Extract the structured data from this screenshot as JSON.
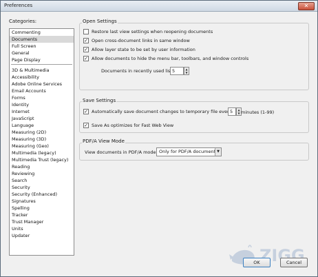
{
  "window": {
    "title": "Preferences",
    "close_glyph": "✕"
  },
  "categories": {
    "label": "Categories:",
    "top": [
      "Commenting",
      "Documents",
      "Full Screen",
      "General",
      "Page Display"
    ],
    "selected": "Documents",
    "rest": [
      "3D & Multimedia",
      "Accessibility",
      "Adobe Online Services",
      "Email Accounts",
      "Forms",
      "Identity",
      "Internet",
      "JavaScript",
      "Language",
      "Measuring (2D)",
      "Measuring (3D)",
      "Measuring (Geo)",
      "Multimedia (legacy)",
      "Multimedia Trust (legacy)",
      "Reading",
      "Reviewing",
      "Search",
      "Security",
      "Security (Enhanced)",
      "Signatures",
      "Spelling",
      "Tracker",
      "Trust Manager",
      "Units",
      "Updater"
    ]
  },
  "open_settings": {
    "title": "Open Settings",
    "options": [
      {
        "label": "Restore last view settings when reopening documents",
        "checked": false
      },
      {
        "label": "Open cross-document links in same window",
        "checked": true
      },
      {
        "label": "Allow layer state to be set by user information",
        "checked": true
      },
      {
        "label": "Allow documents to hide the menu bar, toolbars, and window controls",
        "checked": true
      }
    ],
    "recent_label": "Documents in recently used list:",
    "recent_value": "5"
  },
  "save_settings": {
    "title": "Save Settings",
    "autosave_label": "Automatically save document changes to temporary file every:",
    "autosave_checked": true,
    "autosave_value": "5",
    "minutes_label": "minutes (1-99)",
    "fast_web_label": "Save As optimizes for Fast Web View",
    "fast_web_checked": true
  },
  "pdfa": {
    "title": "PDF/A View Mode",
    "label": "View documents in PDF/A mode:",
    "value": "Only for PDF/A documents"
  },
  "buttons": {
    "ok": "OK",
    "cancel": "Cancel"
  },
  "watermark": {
    "text": "ZIGG",
    "accent": "#b9c6d8"
  },
  "colors": {
    "checkmark": "#222222",
    "selection": "#d9d9d9"
  }
}
